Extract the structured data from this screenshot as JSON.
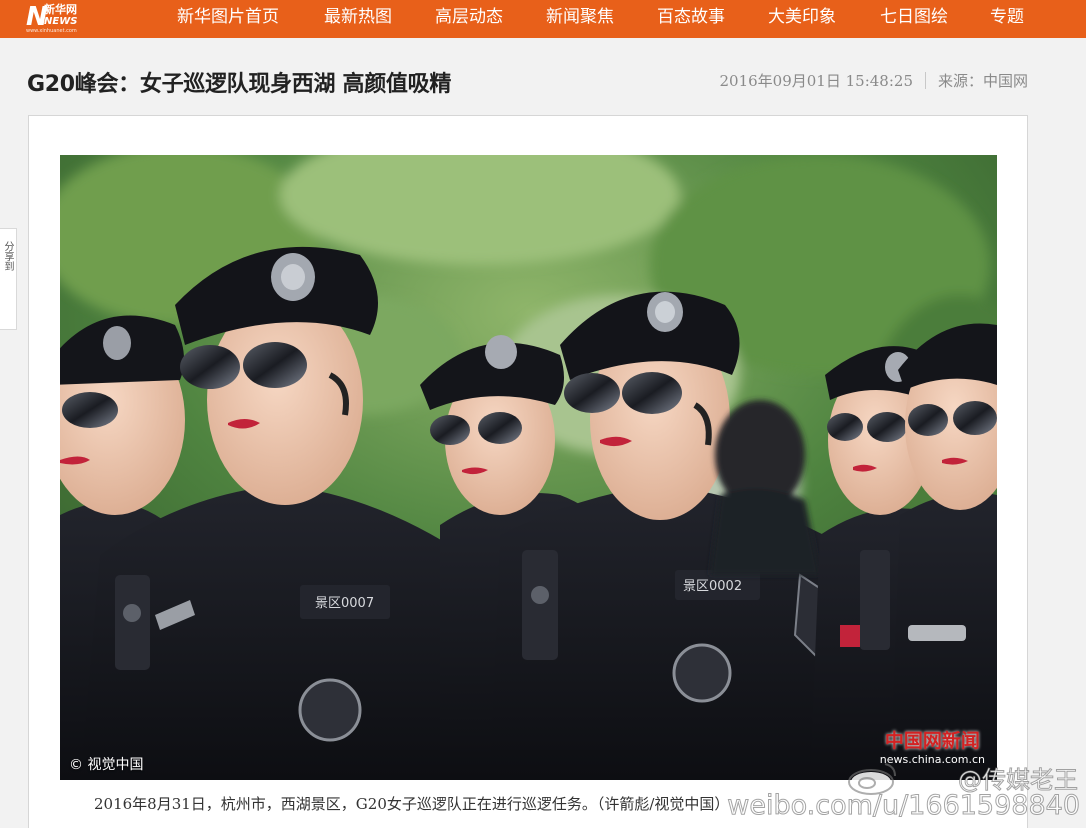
{
  "site": {
    "logo_big": "N",
    "logo_cn": "新华网",
    "logo_news": "NEWS",
    "logo_url": "www.xinhuanet.com"
  },
  "nav": {
    "items": [
      "新华图片首页",
      "最新热图",
      "高层动态",
      "新闻聚焦",
      "百态故事",
      "大美印象",
      "七日图绘",
      "专题"
    ]
  },
  "article": {
    "title": "G20峰会：女子巡逻队现身西湖 高颜值吸精",
    "datetime": "2016年09月01日  15:48:25",
    "source": "来源：中国网",
    "caption": "2016年8月31日，杭州市，西湖景区，G20女子巡逻队正在进行巡逻任务。（许箭彪/视觉中国）",
    "photo_credit": "© 视觉中国",
    "photo_watermark_cn": "中国网新闻",
    "photo_watermark_en": "news.china.com.cn",
    "badge_left": "景区0007",
    "badge_center": "景区0002"
  },
  "side_tab": {
    "label": "分享到"
  },
  "watermark": {
    "line1": "@传媒老王",
    "line2": "weibo.com/u/1661598840"
  },
  "colors": {
    "brand_orange": "#e8601a",
    "uniform": "#15161c",
    "lipstick": "#c2233a"
  }
}
